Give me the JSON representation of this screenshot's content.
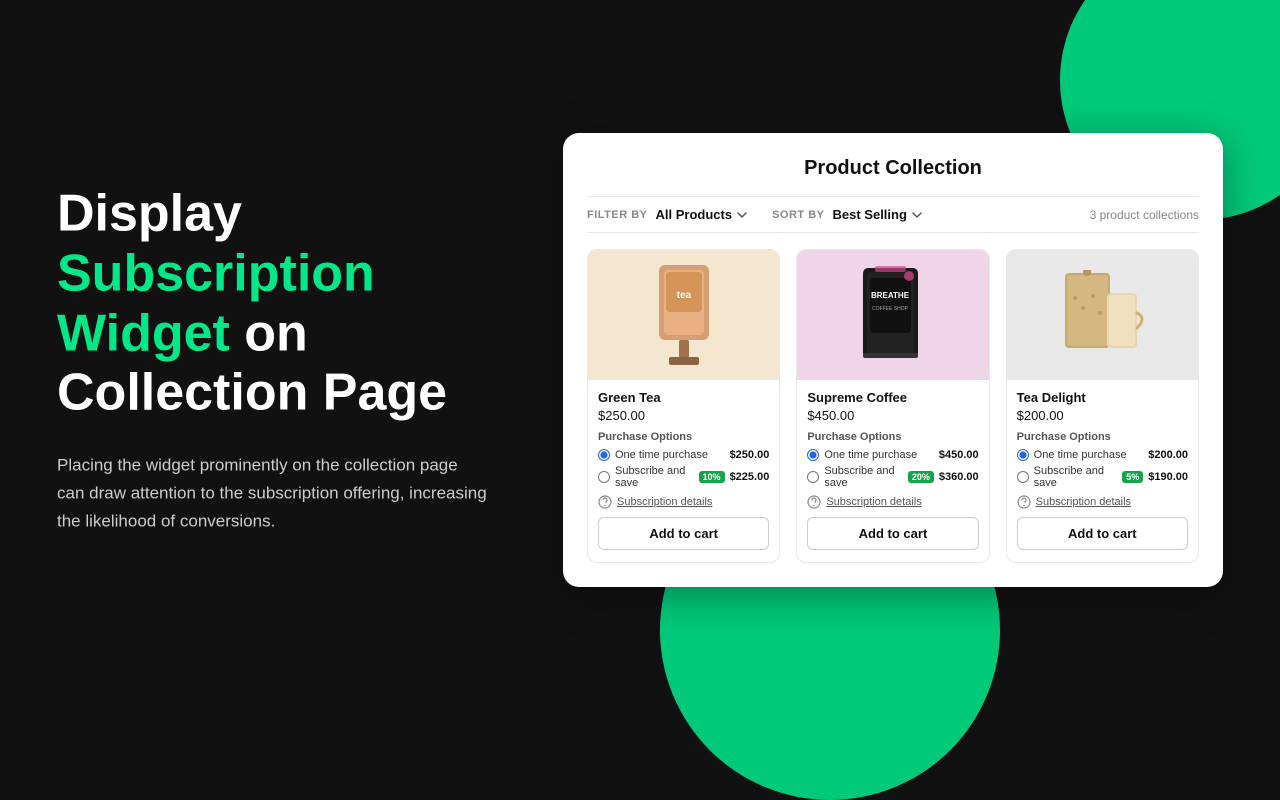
{
  "background": {
    "color": "#111111"
  },
  "left_panel": {
    "headline_part1": "Display ",
    "headline_teal": "Subscription Widget",
    "headline_part2": " on Collection Page",
    "description": "Placing the widget prominently on the collection page can draw attention to the subscription offering, increasing the likelihood of conversions."
  },
  "collection": {
    "title": "Product Collection",
    "filter_label": "FILTER BY",
    "filter_value": "All Products",
    "sort_label": "SORT BY",
    "sort_value": "Best Selling",
    "count_text": "3 product collections",
    "products": [
      {
        "id": "green-tea",
        "name": "Green Tea",
        "price": "$250.00",
        "bg_class": "bg-peach",
        "purchase_options_label": "Purchase Options",
        "options": [
          {
            "type": "one_time",
            "label": "One time purchase",
            "price": "$250.00",
            "checked": true,
            "badge": null
          },
          {
            "type": "subscribe",
            "label": "Subscribe and save",
            "price": "$225.00",
            "checked": false,
            "badge": "10%"
          }
        ],
        "subscription_details_label": "Subscription details",
        "add_to_cart_label": "Add to cart"
      },
      {
        "id": "supreme-coffee",
        "name": "Supreme Coffee",
        "price": "$450.00",
        "bg_class": "bg-pink",
        "purchase_options_label": "Purchase Options",
        "options": [
          {
            "type": "one_time",
            "label": "One time purchase",
            "price": "$450.00",
            "checked": true,
            "badge": null
          },
          {
            "type": "subscribe",
            "label": "Subscribe and save",
            "price": "$360.00",
            "checked": false,
            "badge": "20%"
          }
        ],
        "subscription_details_label": "Subscription details",
        "add_to_cart_label": "Add to cart"
      },
      {
        "id": "tea-delight",
        "name": "Tea Delight",
        "price": "$200.00",
        "bg_class": "bg-gray",
        "purchase_options_label": "Purchase Options",
        "options": [
          {
            "type": "one_time",
            "label": "One time purchase",
            "price": "$200.00",
            "checked": true,
            "badge": null
          },
          {
            "type": "subscribe",
            "label": "Subscribe and save",
            "price": "$190.00",
            "checked": false,
            "badge": "5%"
          }
        ],
        "subscription_details_label": "Subscription details",
        "add_to_cart_label": "Add to cart"
      }
    ]
  }
}
